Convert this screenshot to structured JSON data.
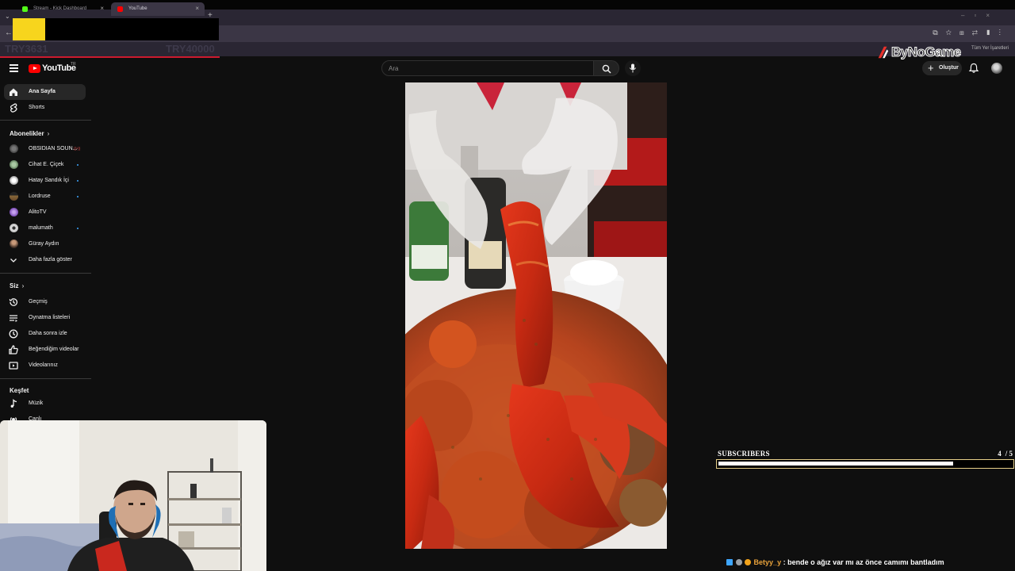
{
  "browser": {
    "tabs": [
      {
        "title": "Stream - Kick Dashboard",
        "icon": "kick-icon",
        "color": "#53fc18"
      },
      {
        "title": "YouTube",
        "icon": "youtube-icon",
        "color": "#ff0000"
      }
    ],
    "new_tab": "+",
    "bookmarks_label": "Tüm Yer İşaretleri",
    "overlay_left": "TRY3631",
    "overlay_right": "TRY40000"
  },
  "brand_overlay": {
    "text": "ByNoGame"
  },
  "youtube": {
    "logo_text": "YouTube",
    "logo_region": "TR",
    "search": {
      "placeholder": "Ara"
    },
    "create_label": "Oluştur",
    "sidebar": {
      "main": [
        {
          "label": "Ana Sayfa",
          "icon": "home-icon",
          "active": true
        },
        {
          "label": "Shorts",
          "icon": "shorts-icon",
          "active": false
        }
      ],
      "subscriptions_title": "Abonelikler",
      "subscriptions": [
        {
          "label": "OBSIDIAN SOUN...",
          "live": true,
          "dot": false,
          "color": "#555555"
        },
        {
          "label": "Cihat E. Çiçek",
          "live": false,
          "dot": true,
          "color": "#6c8f6a"
        },
        {
          "label": "Hatay Sandık İçi",
          "live": false,
          "dot": true,
          "color": "#bbbbbb"
        },
        {
          "label": "Lordruse",
          "live": false,
          "dot": true,
          "color": "#8a6a3a"
        },
        {
          "label": "AlitoTV",
          "live": false,
          "dot": false,
          "color": "#7a4ab0"
        },
        {
          "label": "malumath",
          "live": false,
          "dot": true,
          "color": "#d0d0d0"
        },
        {
          "label": "Güray Aydın",
          "live": false,
          "dot": false,
          "color": "#6a4a3a"
        }
      ],
      "show_more": "Daha fazla göster",
      "you_title": "Siz",
      "you": [
        {
          "label": "Geçmiş",
          "icon": "history-icon"
        },
        {
          "label": "Oynatma listeleri",
          "icon": "playlists-icon"
        },
        {
          "label": "Daha sonra izle",
          "icon": "watch-later-icon"
        },
        {
          "label": "Beğendiğim videolar",
          "icon": "liked-icon"
        },
        {
          "label": "Videolarınız",
          "icon": "your-videos-icon"
        }
      ],
      "explore_title": "Keşfet",
      "explore": [
        {
          "label": "Müzik",
          "icon": "music-icon"
        },
        {
          "label": "Canlı",
          "icon": "live-icon"
        }
      ]
    }
  },
  "subscribers_goal": {
    "title": "SUBSCRIBERS",
    "current": "4",
    "target": "/ 5",
    "progress": 0.8
  },
  "chat": {
    "username": "Betyy_y",
    "separator": ":",
    "message": "bende o ağız var mı az önce camımı bantladım"
  }
}
